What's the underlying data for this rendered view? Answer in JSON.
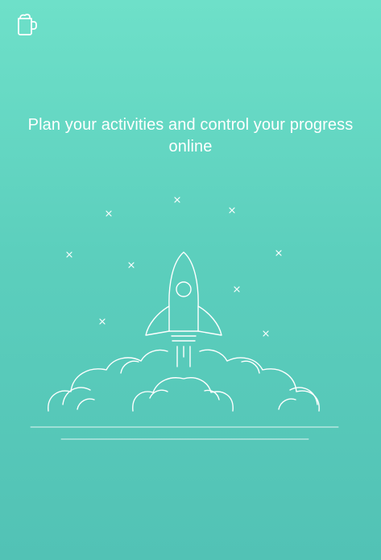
{
  "app": {
    "logo_icon": "mug-icon"
  },
  "onboarding": {
    "headline": "Plan your activities and control your progress online",
    "illustration_icon": "rocket-launch-icon"
  },
  "colors": {
    "background_top": "#6ee0c9",
    "background_bottom": "#52c2b5",
    "line": "#ffffff"
  }
}
